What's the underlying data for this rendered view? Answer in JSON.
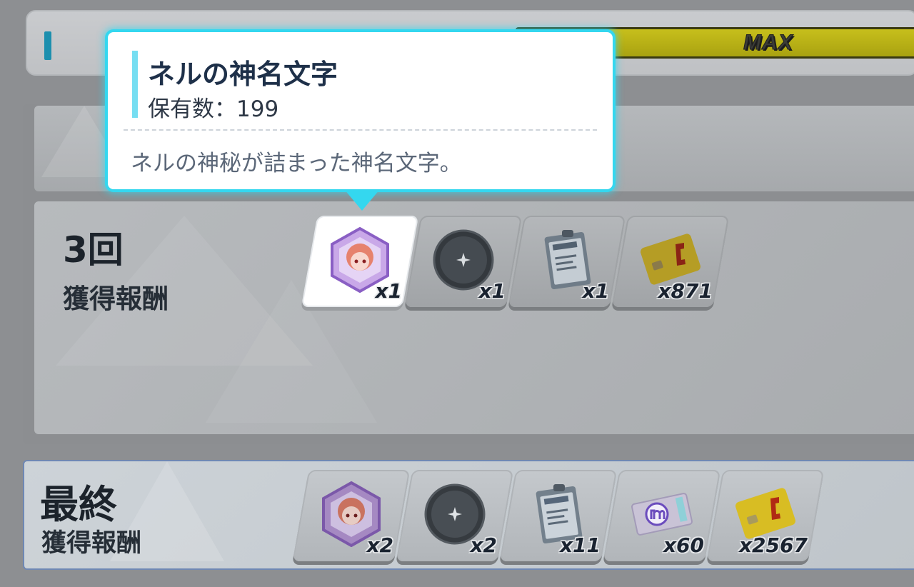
{
  "status": {
    "max_label": "MAX"
  },
  "tooltip": {
    "title": "ネルの神名文字",
    "count_label": "保有数：199",
    "description": "ネルの神秘が詰まった神名文字。"
  },
  "round3": {
    "count": "3回",
    "label": "獲得報酬",
    "items": [
      {
        "icon": "nell-eleph-icon",
        "quantity": "x1"
      },
      {
        "icon": "dark-orb-icon",
        "quantity": "x1"
      },
      {
        "icon": "report-icon",
        "quantity": "x1"
      },
      {
        "icon": "credit-card-icon",
        "quantity": "x871"
      }
    ]
  },
  "final": {
    "title": "最終",
    "label": "獲得報酬",
    "items": [
      {
        "icon": "nell-eleph-icon",
        "quantity": "x2"
      },
      {
        "icon": "dark-orb-icon",
        "quantity": "x2"
      },
      {
        "icon": "report-icon",
        "quantity": "x11"
      },
      {
        "icon": "ticket-icon",
        "quantity": "x60"
      },
      {
        "icon": "credit-card-icon",
        "quantity": "x2567"
      }
    ]
  },
  "colors": {
    "tooltip_border": "#34d7ef",
    "max_bar": "#c7bf1c",
    "final_border": "#6f88b4"
  }
}
